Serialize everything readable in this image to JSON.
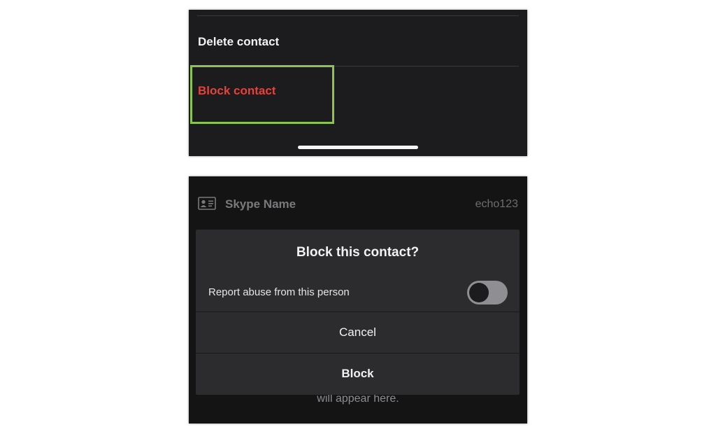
{
  "top_panel": {
    "delete_label": "Delete contact",
    "block_label": "Block contact"
  },
  "bottom_panel": {
    "skype_name_label": "Skype Name",
    "skype_name_value": "echo123",
    "background_hint": "will appear here.",
    "dialog": {
      "title": "Block this contact?",
      "report_label": "Report abuse from this person",
      "report_toggle_on": false,
      "cancel_label": "Cancel",
      "block_label": "Block"
    }
  },
  "colors": {
    "panel_bg": "#1c1c1e",
    "dialog_bg": "#2c2c2e",
    "block_red": "#e5423c",
    "highlight_green": "#8cc450",
    "toggle_off": "#8e8e93"
  },
  "icons": {
    "contact_card": "id-card-icon"
  }
}
